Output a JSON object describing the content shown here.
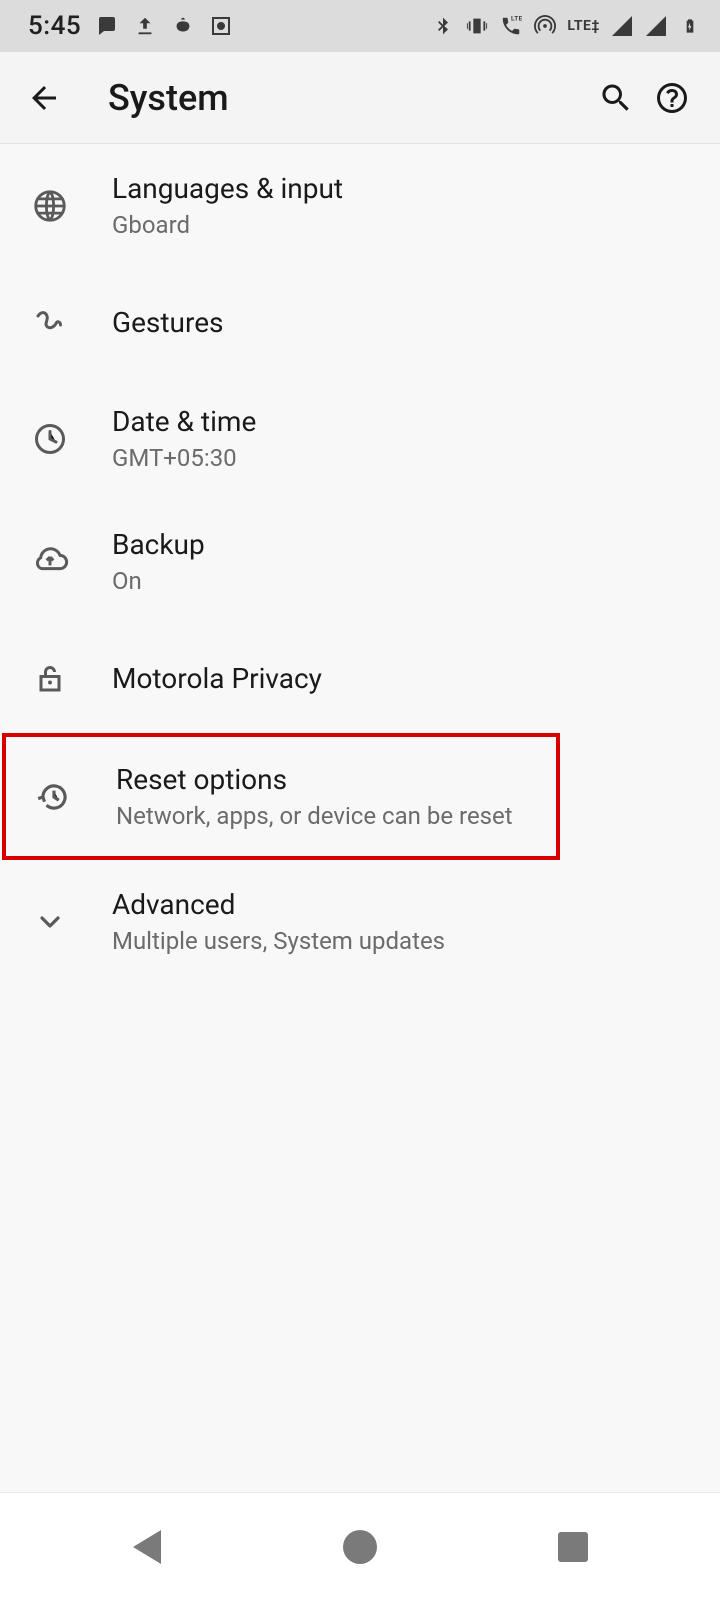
{
  "statusbar": {
    "time": "5:45"
  },
  "appbar": {
    "title": "System"
  },
  "items": [
    {
      "title": "Languages & input",
      "sub": "Gboard"
    },
    {
      "title": "Gestures",
      "sub": ""
    },
    {
      "title": "Date & time",
      "sub": "GMT+05:30"
    },
    {
      "title": "Backup",
      "sub": "On"
    },
    {
      "title": "Motorola Privacy",
      "sub": ""
    },
    {
      "title": "Reset options",
      "sub": "Network, apps, or device can be reset"
    },
    {
      "title": "Advanced",
      "sub": "Multiple users, System updates"
    }
  ]
}
